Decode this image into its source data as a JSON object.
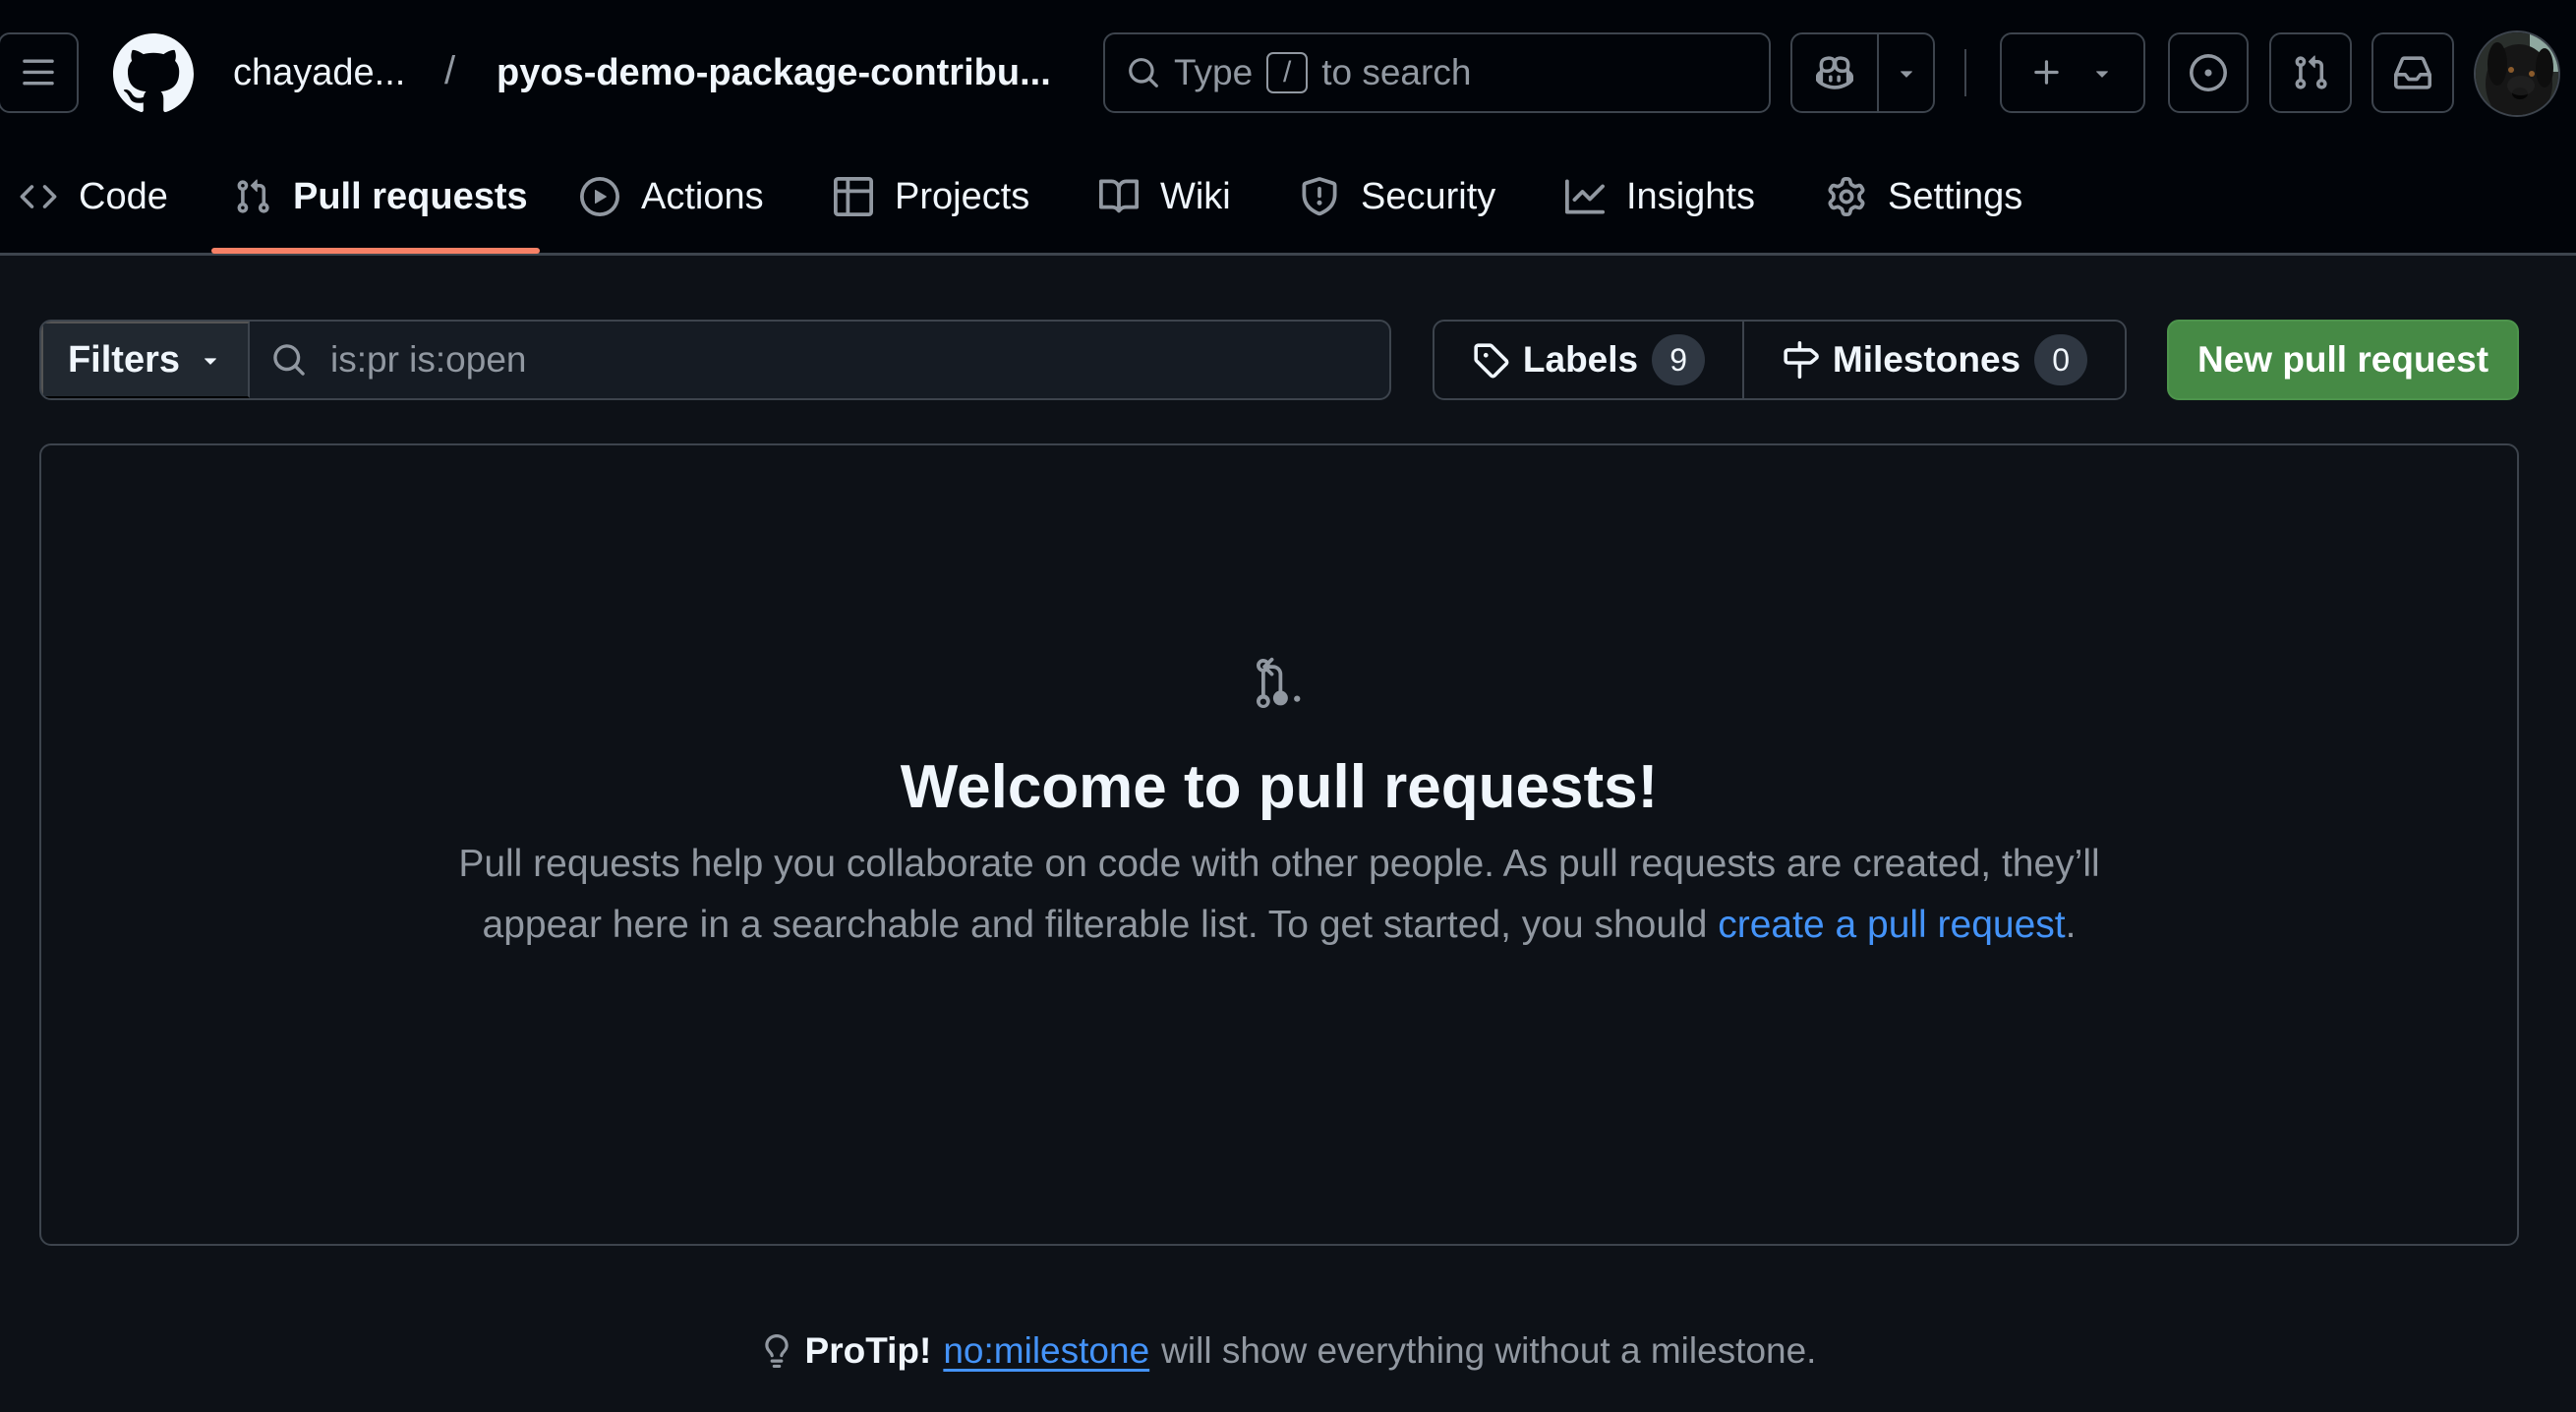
{
  "header": {
    "owner": "chayade...",
    "separator": "/",
    "repo": "pyos-demo-package-contribu...",
    "search": {
      "prefix": "Type",
      "shortcut_key": "/",
      "suffix": "to search"
    },
    "icons": {
      "menu": "hamburger-icon",
      "logo": "github-mark",
      "copilot": "copilot-icon",
      "create": "plus-icon",
      "issues": "issue-opened-icon",
      "pull_requests": "git-pull-request-icon",
      "inbox": "inbox-icon",
      "avatar": "user-avatar-dog-photo"
    }
  },
  "tabs": [
    {
      "label": "Code",
      "icon": "code-icon",
      "active": false
    },
    {
      "label": "Pull requests",
      "icon": "git-pull-request-icon",
      "active": true
    },
    {
      "label": "Actions",
      "icon": "play-icon",
      "active": false
    },
    {
      "label": "Projects",
      "icon": "table-icon",
      "active": false
    },
    {
      "label": "Wiki",
      "icon": "book-icon",
      "active": false
    },
    {
      "label": "Security",
      "icon": "shield-icon",
      "active": false
    },
    {
      "label": "Insights",
      "icon": "graph-icon",
      "active": false
    },
    {
      "label": "Settings",
      "icon": "gear-icon",
      "active": false
    }
  ],
  "subnav": {
    "filters_label": "Filters",
    "filter_query": "is:pr is:open",
    "labels_label": "Labels",
    "labels_count": "9",
    "milestones_label": "Milestones",
    "milestones_count": "0",
    "new_pr_label": "New pull request"
  },
  "blankslate": {
    "title": "Welcome to pull requests!",
    "text_before": "Pull requests help you collaborate on code with other people. As pull requests are created, they’ll appear here in a searchable and filterable list. To get started, you should ",
    "link_text": "create a pull request",
    "text_after": "."
  },
  "protip": {
    "label": "ProTip!",
    "link_text": "no:milestone",
    "text": "will show everything without a milestone."
  },
  "colors": {
    "header_bg": "#010409",
    "page_bg": "#0d1117",
    "border": "#3d444d",
    "muted_text": "#9198a1",
    "link": "#4493f8",
    "active_tab_underline": "#f78166",
    "primary_button": "#468a45"
  }
}
